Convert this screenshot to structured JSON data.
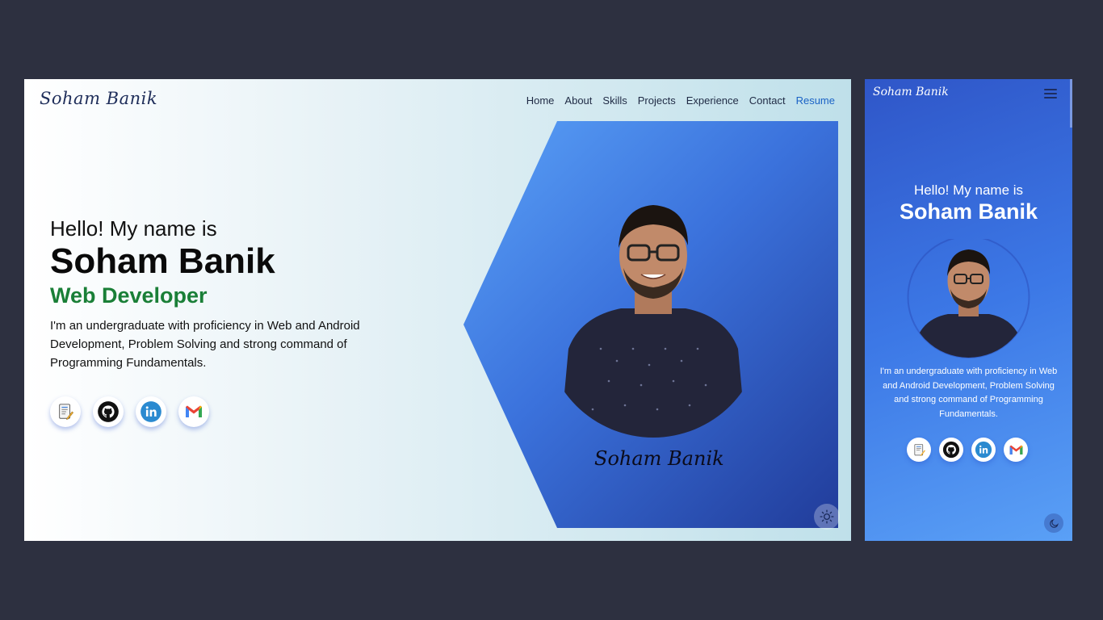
{
  "desktop": {
    "logo": "Soham Banik",
    "nav": [
      "Home",
      "About",
      "Skills",
      "Projects",
      "Experience",
      "Contact",
      "Resume"
    ],
    "hero": {
      "greeting": "Hello! My name is",
      "name": "Soham Banik",
      "role": "Web Developer",
      "description": "I'm an undergraduate with proficiency in Web and Android Development, Problem Solving and strong command of Programming Fundamentals."
    },
    "signature": "Soham Banik",
    "socials": [
      "resume-icon",
      "github-icon",
      "linkedin-icon",
      "gmail-icon"
    ],
    "theme_icon": "sun-icon"
  },
  "mobile": {
    "logo": "Soham Banik",
    "menu_icon": "hamburger-icon",
    "greeting": "Hello! My name is",
    "name": "Soham Banik",
    "description": "I'm an undergraduate with proficiency in Web and Android Development, Problem Solving and strong command of Programming Fundamentals.",
    "socials": [
      "resume-icon",
      "github-icon",
      "linkedin-icon",
      "gmail-icon"
    ],
    "theme_icon": "moon-icon"
  },
  "colors": {
    "background": "#2d3040",
    "accent_green": "#1a7f37",
    "resume_link": "#1b63c6",
    "panel_blue": "#3b72dc"
  }
}
